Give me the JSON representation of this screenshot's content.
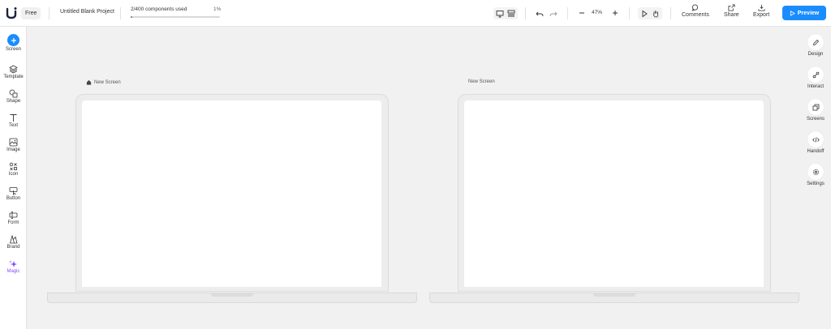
{
  "topbar": {
    "plan_badge": "Free",
    "project_name": "Untitled Blank Project",
    "usage_text": "2/400 components used",
    "usage_percent": "1%",
    "usage_fraction": 0.01,
    "zoom": "47%",
    "comments_label": "Comments",
    "share_label": "Share",
    "export_label": "Export",
    "preview_label": "Preview"
  },
  "left_tools": [
    {
      "label": "Screen",
      "icon": "plus-icon"
    },
    {
      "label": "Template",
      "icon": "layers-icon"
    },
    {
      "label": "Shape",
      "icon": "shapes-icon"
    },
    {
      "label": "Text",
      "icon": "text-icon"
    },
    {
      "label": "Image",
      "icon": "image-icon"
    },
    {
      "label": "Icon",
      "icon": "icon-grid-icon"
    },
    {
      "label": "Button",
      "icon": "cursor-button-icon"
    },
    {
      "label": "Form",
      "icon": "form-icon"
    },
    {
      "label": "Brand",
      "icon": "brand-icon"
    },
    {
      "label": "Magic",
      "icon": "sparkle-icon"
    }
  ],
  "right_tools": [
    {
      "label": "Design",
      "icon": "pencil-icon"
    },
    {
      "label": "Interact",
      "icon": "link-nodes-icon"
    },
    {
      "label": "Screens",
      "icon": "screens-icon"
    },
    {
      "label": "Handoff",
      "icon": "code-icon"
    },
    {
      "label": "Settings",
      "icon": "gear-icon"
    }
  ],
  "screens": [
    {
      "name": "New Screen",
      "is_home": true
    },
    {
      "name": "New Screen",
      "is_home": false
    }
  ],
  "colors": {
    "accent": "#1a8cff",
    "magic": "#8a4dff"
  }
}
